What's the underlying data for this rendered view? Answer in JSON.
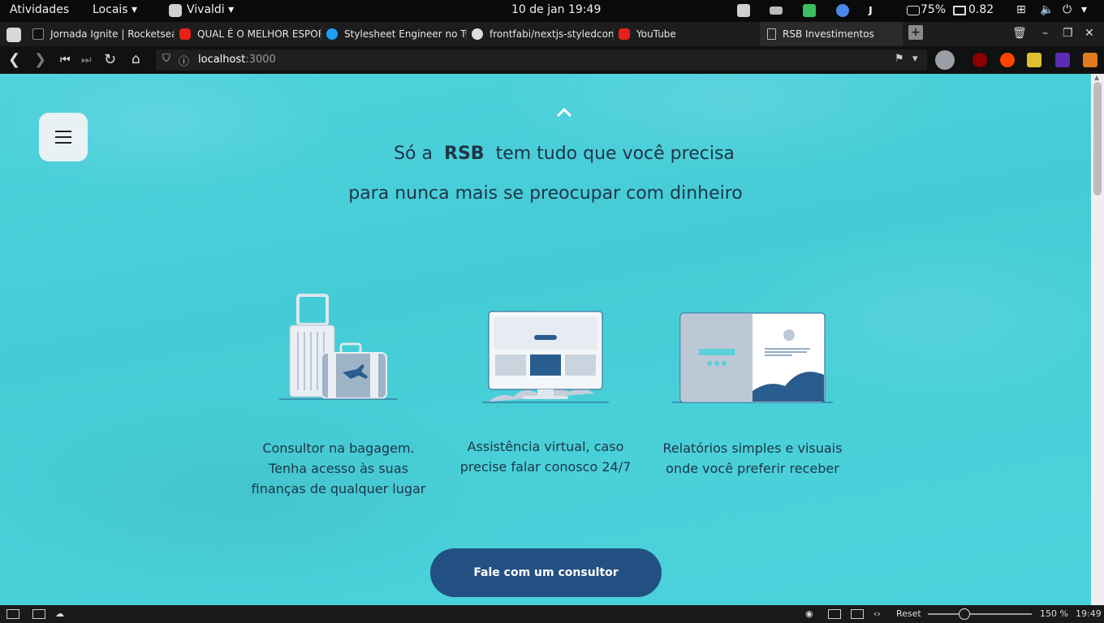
{
  "topbar": {
    "activities": "Atividades",
    "places": "Locais",
    "app": "Vivaldi",
    "clock": "10 de jan  19:49",
    "battery": "75%",
    "load": "0.82"
  },
  "tabs": [
    {
      "title": "Jornada Ignite | Rocketseat",
      "favicon": "rocketseat-icon"
    },
    {
      "title": "QUAL É O MELHOR ESPORTE",
      "favicon": "youtube-icon"
    },
    {
      "title": "Stylesheet Engineer no Twitter",
      "favicon": "twitter-icon"
    },
    {
      "title": "frontfabi/nextjs-styledcomponents",
      "favicon": "github-icon"
    },
    {
      "title": "YouTube",
      "favicon": "youtube-icon"
    },
    {
      "title": "RSB Investimentos",
      "favicon": "page-icon"
    }
  ],
  "address": {
    "host": "localhost",
    "port": ":3000"
  },
  "page": {
    "line1_pre": "Só a",
    "brand": "RSB",
    "line1_post": "tem tudo que você precisa",
    "line2": "para nunca mais se preocupar com dinheiro",
    "features": [
      {
        "l1": "Consultor na bagagem.",
        "l2": "Tenha acesso às suas",
        "l3": "finanças de qualquer lugar"
      },
      {
        "l1": "Assistência virtual, caso",
        "l2": "precise falar conosco 24/7",
        "l3": ""
      },
      {
        "l1": "Relatórios simples e visuais",
        "l2": "onde você preferir receber",
        "l3": ""
      }
    ],
    "cta": "Fale com um consultor"
  },
  "statusbar": {
    "reset": "Reset",
    "zoom": "150 %",
    "time": "19:49",
    "zoom_level": 0.35
  },
  "colors": {
    "page_bg": "#4ccfd9",
    "cta": "#235082",
    "text": "#1f3547"
  }
}
